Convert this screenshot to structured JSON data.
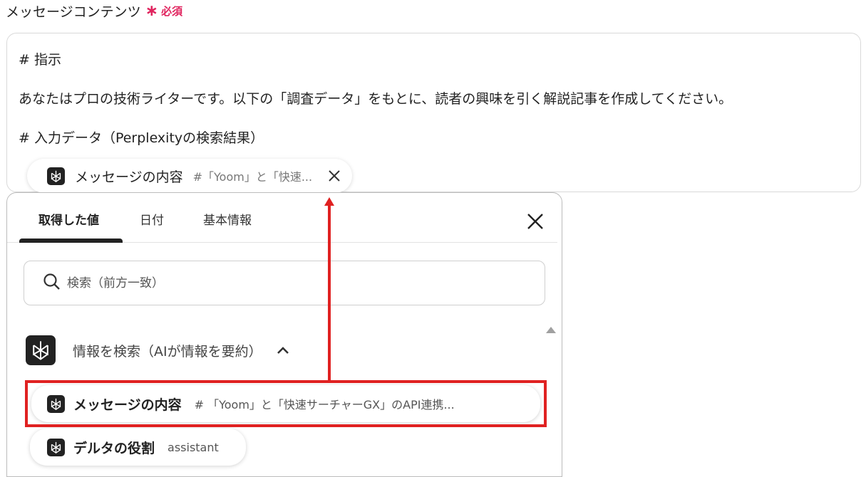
{
  "field": {
    "label": "メッセージコンテンツ",
    "required_star": "∗",
    "required_text": "必須"
  },
  "editor": {
    "lines": [
      "# 指示",
      "あなたはプロの技術ライターです。以下の「調査データ」をもとに、読者の興味を引く解説記事を作成してください。",
      "# 入力データ（Perplexityの検索結果）"
    ],
    "chip": {
      "icon": "perplexity-icon",
      "title": "メッセージの内容",
      "preview": "#「Yoom」と「快速..."
    }
  },
  "panel": {
    "tabs": [
      {
        "label": "取得した値",
        "active": true
      },
      {
        "label": "日付",
        "active": false
      },
      {
        "label": "基本情報",
        "active": false
      }
    ],
    "search": {
      "placeholder": "検索（前方一致）"
    },
    "group": {
      "icon": "perplexity-icon",
      "title": "情報を検索（AIが情報を要約）",
      "expanded": true
    },
    "items": [
      {
        "title": "メッセージの内容",
        "preview": "# 「Yoom」と「快速サーチャーGX」のAPI連携..."
      },
      {
        "title": "デルタの役割",
        "preview": "assistant"
      }
    ]
  },
  "colors": {
    "required": "#e0245e",
    "annotation": "#e02121",
    "icon_bg": "#222222"
  }
}
